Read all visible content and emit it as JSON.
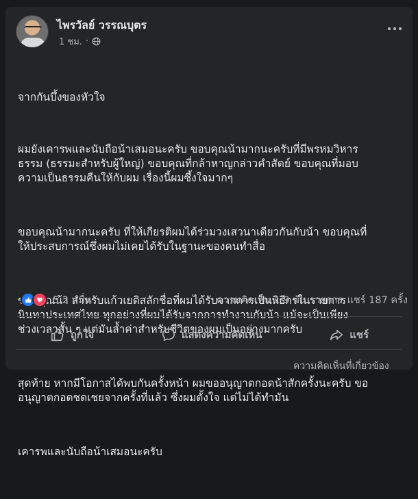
{
  "post": {
    "author": "ไพรวัลย์ วรรณบุตร",
    "time": "1 ชม.",
    "separator": "·",
    "paragraphs": [
      "จากกันบึ้งของหัวใจ",
      "ผมยังเคารพและนับถือน้าเสมอนะครับ ขอบคุณน้ามากนะครับที่มีพรหมวิหาร\nธรรม (ธรรมะสำหรับผู้ใหญ่) ขอบคุณที่กล้าหาญกล่าวคำสัตย์ ขอบคุณที่มอบ\nความเป็นธรรมคืนให้กับผม เรื่องนี้ผมซึ้งใจมากๆ",
      "ขอบคุณน้ามากนะครับ ที่ให้เกียรติผมได้ร่วมวงเสวนาเดียวกันกับน้า ขอบคุณที่\nให้ประสบการณ์ซึ่งผมไม่เคยได้รับในฐานะของคนทำสื่อ",
      "ขอบคุณน้า สำหรับแก้วเยติสลักชื่อที่ผมได้รับจากการเป็นพิธีกรในรายการ\nนินทาประเทศไทย ทุกอย่างที่ผมได้รับจากการทำงานกับน้า แม้จะเป็นเพียง\nช่วงเวลาสั้น ๆ แต่มันล้ำค่าสำหรับชีวิตของผมเป็นอย่างมากครับ",
      "สุดท้าย หากมีโอกาสได้พบกันครั้งหน้า ผมขออนุญาตกอดน้าสักครั้งนะครับ ขอ\nอนุญาตกอดชดเชยจากครั้งที่แล้ว ซึ่งผมตั้งใจ แต่ไม่ได้ทำมัน",
      "เคารพและนับถือน้าเสมอนะครับ"
    ]
  },
  "stats": {
    "reactions_count": "5.2 หมื่น",
    "comments": "ความคิดเห็น 1.9 พัน รายการ",
    "shares": "แชร์ 187 ครั้ง"
  },
  "actions": {
    "like": "ถูกใจ",
    "comment": "แสดงความคิดเห็น",
    "share": "แชร์"
  },
  "footer_peek": "ความคิดเห็นที่เกี่ยวข้อง",
  "icons": [
    "globe-icon",
    "more-icon",
    "like-reaction-icon",
    "love-reaction-icon",
    "thumbs-up-icon",
    "comment-icon",
    "share-icon"
  ],
  "colors": {
    "background": "#18191a",
    "card": "#242526",
    "text": "#e4e6eb",
    "muted": "#b0b3b8",
    "like_blue": "#2078f4",
    "love_red": "#f3425f"
  }
}
